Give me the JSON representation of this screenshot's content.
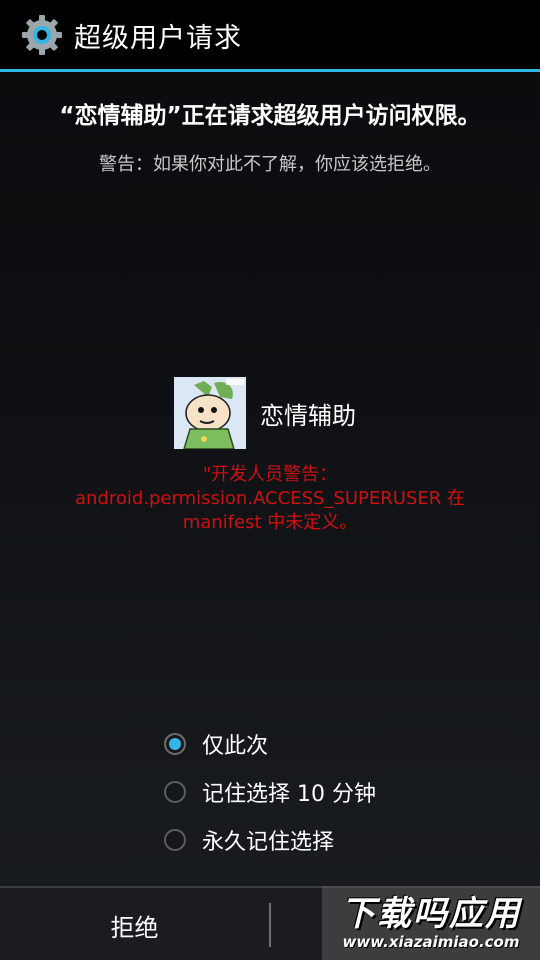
{
  "action_bar": {
    "title": "超级用户请求",
    "icon": "gear-icon",
    "accent_color": "#33b5e5"
  },
  "request": {
    "text": "“恋情辅助”正在请求超级用户访问权限。",
    "warning": "警告：如果你对此不了解，你应该选拒绝。"
  },
  "app": {
    "name": "恋情辅助",
    "avatar_icon": "app-avatar-cartoon",
    "dev_warning_lines": [
      "\"开发人员警告：",
      "android.permission.ACCESS_SUPERUSER 在",
      "manifest 中未定义。"
    ],
    "dev_warning_color": "#cc1111"
  },
  "options": [
    {
      "label": "仅此次",
      "checked": true
    },
    {
      "label": "记住选择 10 分钟",
      "checked": false
    },
    {
      "label": "永久记住选择",
      "checked": false
    }
  ],
  "buttons": {
    "deny": "拒绝"
  },
  "watermark": {
    "logo": "下载吗应用",
    "url": "www.xiazaimiao.com"
  }
}
